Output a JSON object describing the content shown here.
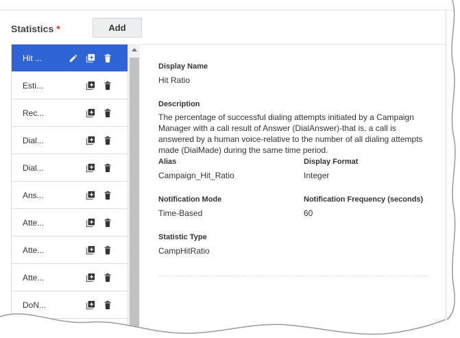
{
  "section": {
    "title": "Statistics",
    "required_mark": "*",
    "add_label": "Add"
  },
  "statistics_list": [
    {
      "label": "Hit ...",
      "selected": true
    },
    {
      "label": "Esti...",
      "selected": false
    },
    {
      "label": "Rec...",
      "selected": false
    },
    {
      "label": "Dial...",
      "selected": false
    },
    {
      "label": "Dial...",
      "selected": false
    },
    {
      "label": "Ans...",
      "selected": false
    },
    {
      "label": "Atte...",
      "selected": false
    },
    {
      "label": "Atte...",
      "selected": false
    },
    {
      "label": "Atte...",
      "selected": false
    },
    {
      "label": "DoN...",
      "selected": false
    }
  ],
  "details": {
    "display_name_label": "Display Name",
    "display_name": "Hit Ratio",
    "description_label": "Description",
    "description": "The percentage of successful dialing attempts initiated by a Campaign Manager with a call result of Answer (DialAnswer)-that is, a call is answered by a human voice-relative to the number of all dialing attempts made (DialMade) during the same time period.",
    "alias_label": "Alias",
    "alias": "Campaign_Hit_Ratio",
    "display_format_label": "Display Format",
    "display_format": "Integer",
    "notification_mode_label": "Notification Mode",
    "notification_mode": "Time-Based",
    "notification_frequency_label": "Notification Frequency (seconds)",
    "notification_frequency": "60",
    "statistic_type_label": "Statistic Type",
    "statistic_type": "CampHitRatio"
  },
  "colors": {
    "selected": "#2f64d6",
    "required": "#d9382a",
    "scroll_thumb": "#c1c1c1"
  }
}
